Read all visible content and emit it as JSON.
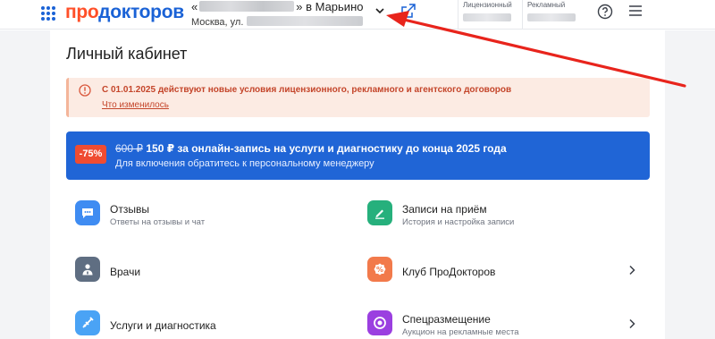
{
  "header": {
    "logo": {
      "part1": "про",
      "part2": "докторов"
    },
    "clinic": {
      "name_prefix": "«",
      "name_suffix": "» в Марьино",
      "address_prefix": "Москва, ул."
    },
    "balances": [
      {
        "label": "Лицензионный"
      },
      {
        "label": "Рекламный"
      }
    ]
  },
  "page": {
    "title": "Личный кабинет"
  },
  "notice": {
    "text": "С 01.01.2025 действуют новые условия лицензионного, рекламного и агентского договоров",
    "link": "Что изменилось"
  },
  "promo": {
    "badge": "-75%",
    "old_price": "600 ₽",
    "text": "150 ₽ за онлайн-запись на услуги и диагностику до конца 2025 года",
    "subtext": "Для включения обратитесь к персональному менеджеру"
  },
  "tiles": [
    {
      "title": "Отзывы",
      "subtitle": "Ответы на отзывы и чат",
      "icon": "chat-icon",
      "color": "#3f8cf2"
    },
    {
      "title": "Записи на приём",
      "subtitle": "История и настройка записи",
      "icon": "pen-icon",
      "color": "#26b07c"
    },
    {
      "title": "Врачи",
      "subtitle": "",
      "icon": "doctor-icon",
      "color": "#5f6e82"
    },
    {
      "title": "Клуб ПроДокторов",
      "subtitle": "",
      "icon": "percent-icon",
      "color": "#f27a4b"
    },
    {
      "title": "Услуги и диагностика",
      "subtitle": "",
      "icon": "syringe-icon",
      "color": "#4aa3f5"
    },
    {
      "title": "Спецразмещение",
      "subtitle": "Аукцион на рекламные места",
      "icon": "target-icon",
      "color": "#9b3fe0"
    }
  ],
  "colors": {
    "brand_blue": "#1a62d6",
    "brand_orange": "#ff4f28",
    "notice_text": "#c4452a",
    "promo_bg": "#2065d6"
  }
}
